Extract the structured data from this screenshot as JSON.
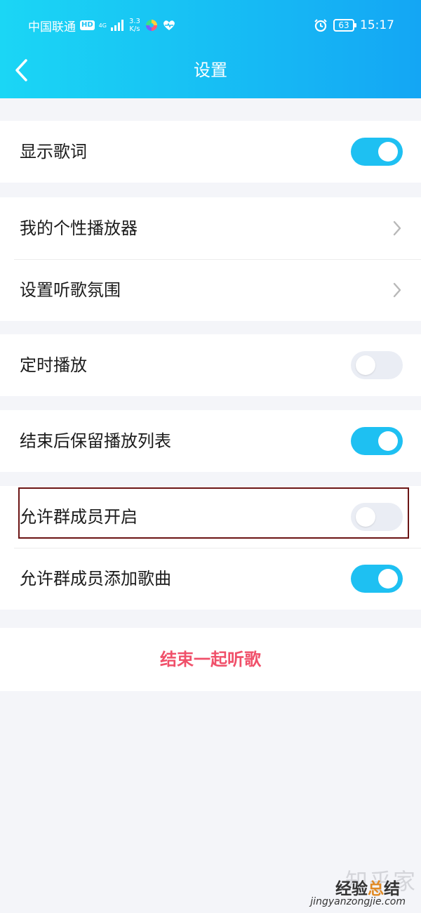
{
  "status_bar": {
    "carrier": "中国联通",
    "hd_badge": "HD",
    "net_type_top": "4G",
    "net_type_bottom": "",
    "speed_value": "3.3",
    "speed_unit": "K/s",
    "battery_level": "63",
    "time": "15:17"
  },
  "header": {
    "title": "设置"
  },
  "settings": {
    "show_lyrics": {
      "label": "显示歌词",
      "enabled": true
    },
    "my_player": {
      "label": "我的个性播放器"
    },
    "listening_atmosphere": {
      "label": "设置听歌氛围"
    },
    "timed_playback": {
      "label": "定时播放",
      "enabled": false
    },
    "keep_playlist": {
      "label": "结束后保留播放列表",
      "enabled": true
    },
    "allow_members_start": {
      "label": "允许群成员开启",
      "enabled": false
    },
    "allow_members_add_songs": {
      "label": "允许群成员添加歌曲",
      "enabled": true
    }
  },
  "end_button": {
    "label": "结束一起听歌"
  },
  "watermark": {
    "ghost": "知乎家",
    "main_a": "经验",
    "main_b": "总",
    "main_c": "结",
    "url": "jingyanzongjie.com"
  },
  "colors": {
    "accent": "#1ec0f2",
    "toggle_off": "#eaedf4",
    "danger_text": "#f0506a",
    "highlight_border": "#6b1414"
  }
}
